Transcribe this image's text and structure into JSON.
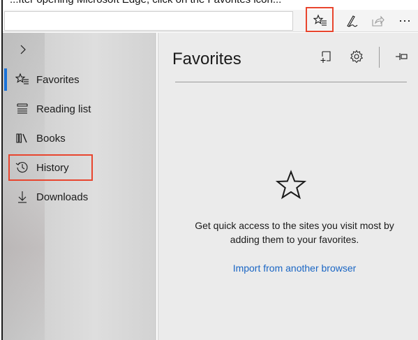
{
  "tutorial_caption": "...fter opening Microsoft Edge, click on the Favorites icon...",
  "toolbar": {
    "address_value": "",
    "icons": [
      "favorites-hub-icon",
      "pen-icon",
      "share-icon",
      "more-icon"
    ],
    "more_label": "⋯"
  },
  "sidebar": {
    "chevron": "›",
    "items": [
      {
        "label": "Favorites",
        "icon": "favorites-list-icon"
      },
      {
        "label": "Reading list",
        "icon": "reading-list-icon"
      },
      {
        "label": "Books",
        "icon": "books-icon"
      },
      {
        "label": "History",
        "icon": "history-icon"
      },
      {
        "label": "Downloads",
        "icon": "download-icon"
      }
    ]
  },
  "panel": {
    "title": "Favorites",
    "empty_message": "Get quick access to the sites you visit most by adding them to your favorites.",
    "import_link": "Import from another browser"
  },
  "colors": {
    "highlight": "#e8452e",
    "accent": "#1a73d9",
    "link": "#1a66c4"
  }
}
